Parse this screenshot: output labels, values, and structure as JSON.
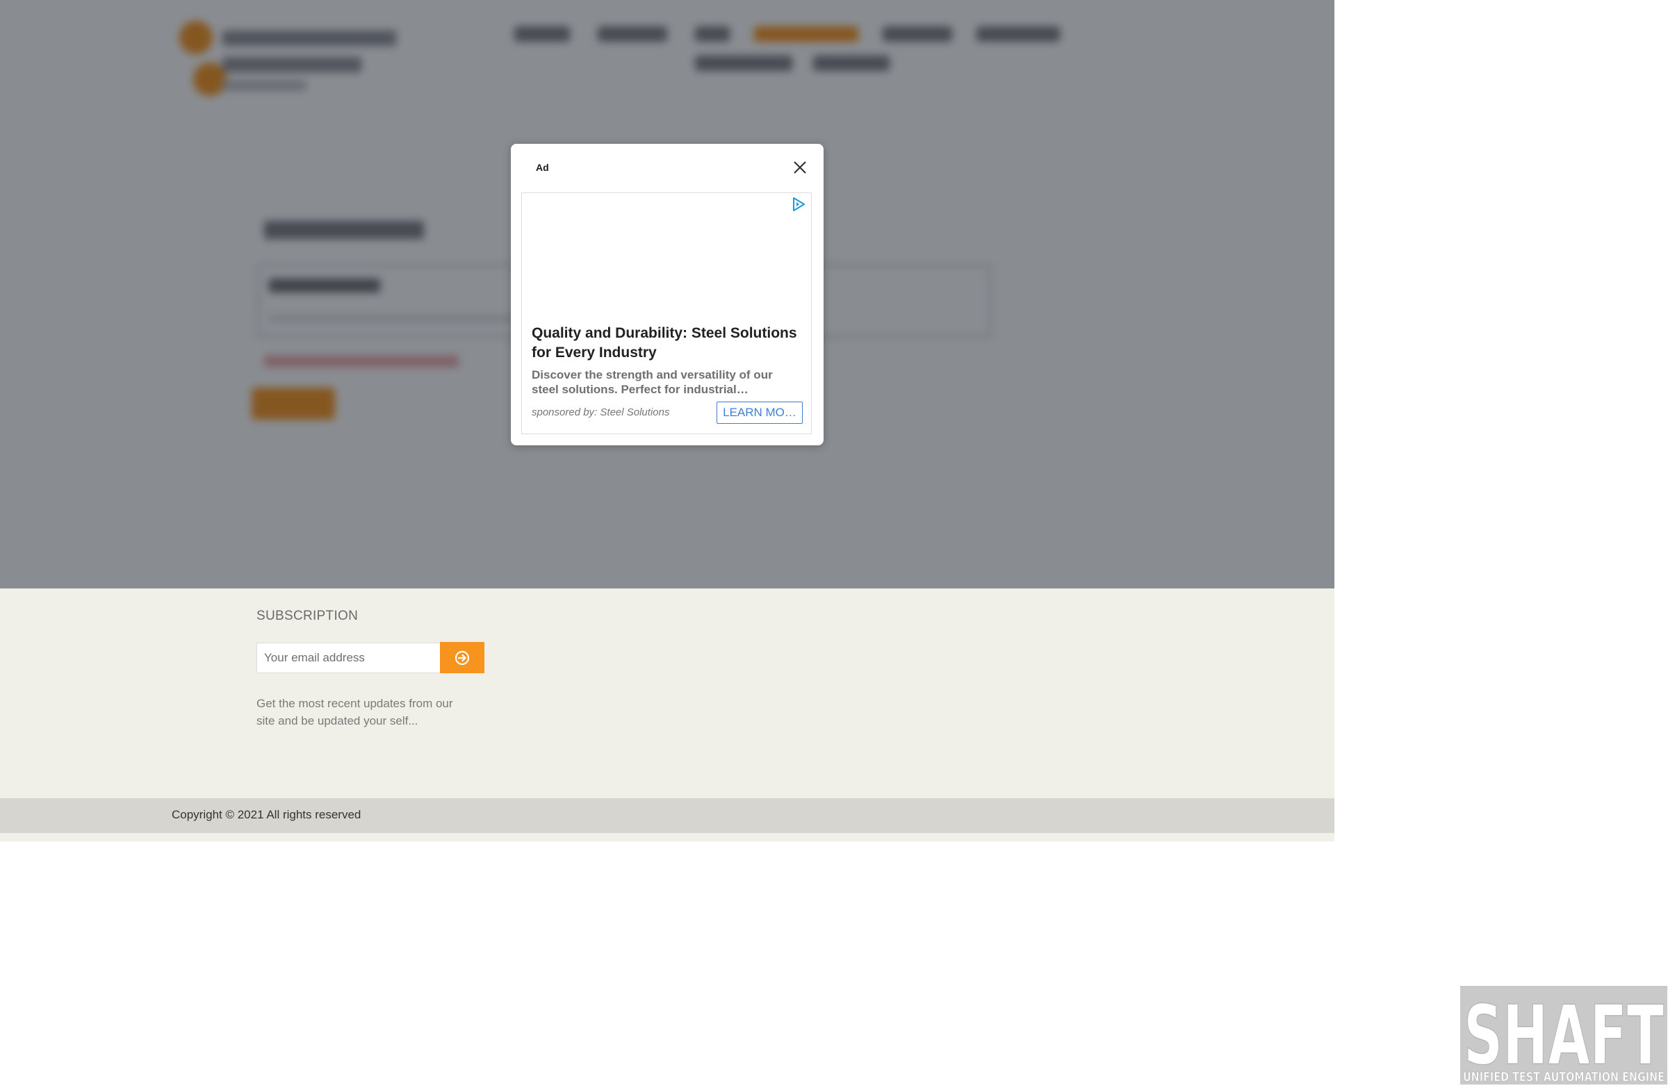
{
  "ad": {
    "label": "Ad",
    "headline": "Quality and Durability: Steel Solutions for Every Industry",
    "description": "Discover the strength and versatility of our steel solutions. Perfect for industrial…",
    "sponsor": "sponsored by: Steel Solutions",
    "cta": "LEARN MO…",
    "close_icon": "close-icon",
    "choices_icon": "ad-choices-icon",
    "cta_color": "#3f7fd1"
  },
  "subscription": {
    "title": "SUBSCRIPTION",
    "email_placeholder": "Your email address",
    "submit_icon": "arrow-circle-right-icon",
    "description": "Get the most recent updates from our site and be updated your self...",
    "button_color": "#f7941d"
  },
  "footer": {
    "copyright": "Copyright © 2021 All rights reserved"
  },
  "watermark": {
    "title": "SHAFT",
    "subtitle": "UNIFIED TEST AUTOMATION ENGINE"
  }
}
